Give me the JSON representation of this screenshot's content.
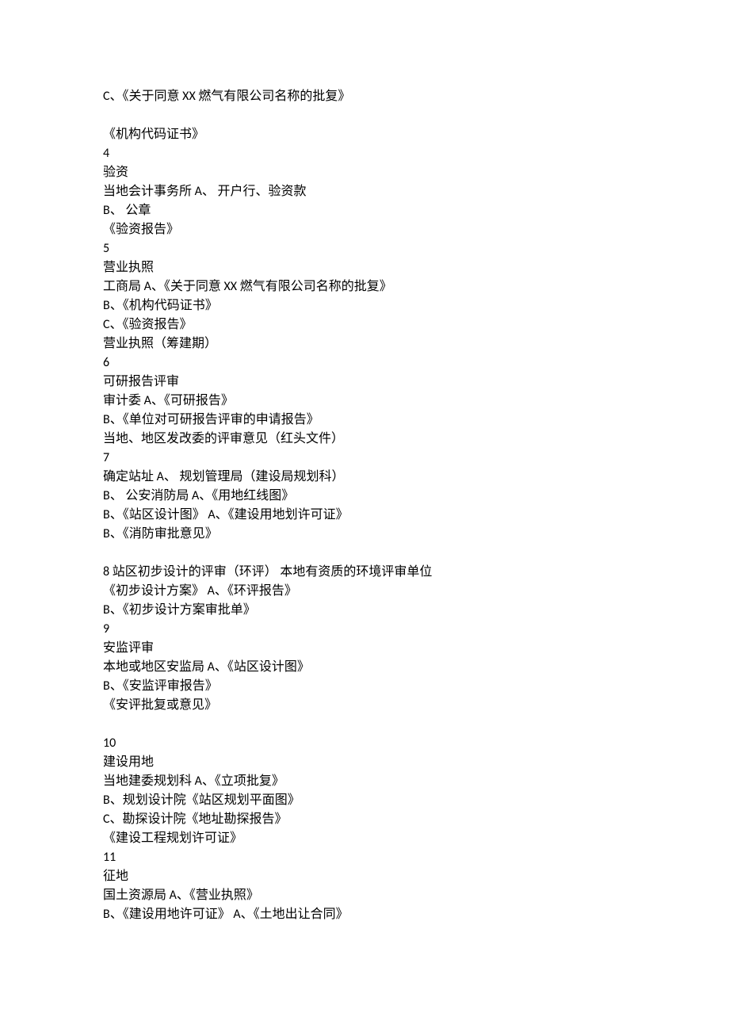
{
  "lines": [
    "C、《关于同意 XX 燃气有限公司名称的批复》",
    "",
    "《机构代码证书》",
    "4",
    "验资",
    "当地会计事务所 A、 开户行、验资款",
    "B、 公章",
    "《验资报告》",
    "5",
    "营业执照",
    "工商局 A、《关于同意 XX 燃气有限公司名称的批复》",
    "B、《机构代码证书》",
    "C、《验资报告》",
    "营业执照（筹建期）",
    "6",
    "可研报告评审",
    "审计委 A、《可研报告》",
    "B、《单位对可研报告评审的申请报告》",
    "当地、地区发改委的评审意见（红头文件）",
    "7",
    "确定站址 A、 规划管理局（建设局规划科）",
    "B、 公安消防局 A、《用地红线图》",
    "B、《站区设计图》 A、《建设用地划许可证》",
    "B、《消防审批意见》",
    "",
    "8 站区初步设计的评审（环评） 本地有资质的环境评审单位",
    "《初步设计方案》 A、《环评报告》",
    "B、《初步设计方案审批单》",
    "9",
    "安监评审",
    "本地或地区安监局 A、《站区设计图》",
    "B、《安监评审报告》",
    "《安评批复或意见》",
    "",
    "10",
    "建设用地",
    "当地建委规划科 A、《立项批复》",
    "B、规划设计院《站区规划平面图》",
    "C、勘探设计院《地址勘探报告》",
    "《建设工程规划许可证》",
    "11",
    "征地",
    "国土资源局 A、《营业执照》",
    "B、《建设用地许可证》 A、《土地出让合同》"
  ]
}
